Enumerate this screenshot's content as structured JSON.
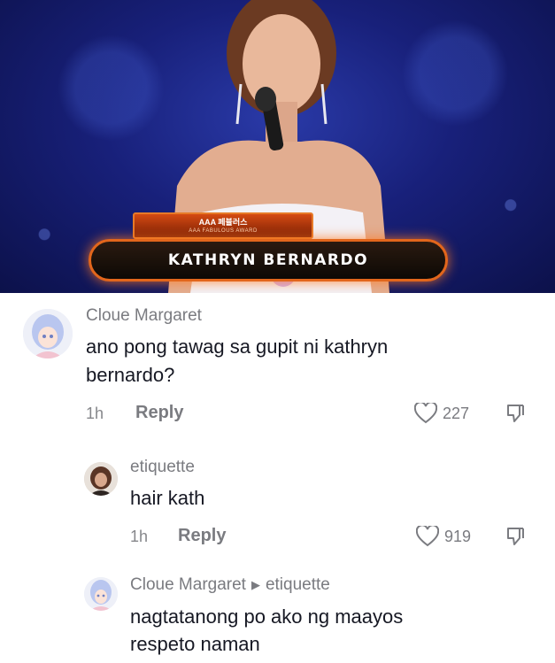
{
  "video": {
    "award_title": "AAA 페뷸러스",
    "award_subtitle": "AAA FABULOUS AWARD",
    "caption_name": "KATHRYN BERNARDO"
  },
  "comments": [
    {
      "username": "Cloue Margaret",
      "text_line1": "ano pong tawag sa gupit ni kathryn",
      "text_line2": "bernardo?",
      "time": "1h",
      "reply_label": "Reply",
      "likes": "227"
    },
    {
      "username": "etiquette",
      "text": "hair kath",
      "time": "1h",
      "reply_label": "Reply",
      "likes": "919"
    },
    {
      "username": "Cloue Margaret",
      "reply_to": "etiquette",
      "text_line1": "nagtatanong po ako ng maayos",
      "text_line2": "respeto naman"
    }
  ],
  "icons": {
    "like": "heart-outline-icon",
    "dislike": "thumbs-down-icon",
    "reply_arrow": "triangle-right-icon"
  },
  "colors": {
    "secondary_text": "#7a7b80",
    "primary_text": "#161823",
    "caption_border": "#e2661c"
  }
}
